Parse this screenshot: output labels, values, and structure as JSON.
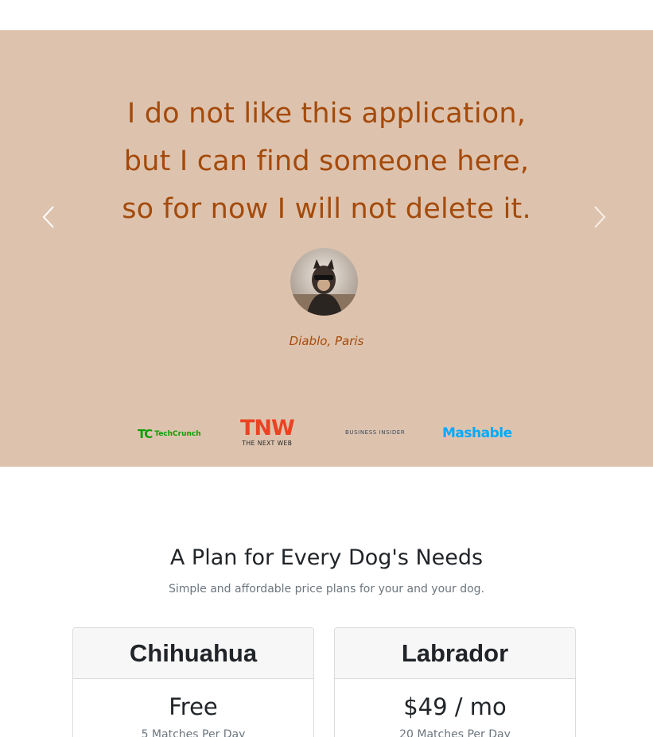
{
  "testimonial": {
    "quote_lines": [
      "I do not like this application,",
      "but I can find someone here,",
      "so for now I will not delete it."
    ],
    "author": "Diablo, Paris",
    "prev_icon": "chevron-left-icon",
    "next_icon": "chevron-right-icon"
  },
  "press_logos": {
    "techcrunch": {
      "mark": "TC",
      "text": "TechCrunch"
    },
    "tnw": {
      "mark": "TNW",
      "text": "THE NEXT WEB"
    },
    "business_insider": {
      "text": "BUSINESS INSIDER"
    },
    "mashable": {
      "text": "Mashable"
    }
  },
  "pricing": {
    "title": "A Plan for Every Dog's Needs",
    "subtitle": "Simple and affordable price plans for your and your dog.",
    "plans": [
      {
        "name": "Chihuahua",
        "price": "Free",
        "note": "5 Matches Per Day"
      },
      {
        "name": "Labrador",
        "price": "$49 / mo",
        "note": "20 Matches Per Day"
      }
    ]
  },
  "colors": {
    "testimonial_bg": "#ddc3ae",
    "quote_text": "#a44a0b",
    "card_header_bg": "#f7f7f7"
  }
}
